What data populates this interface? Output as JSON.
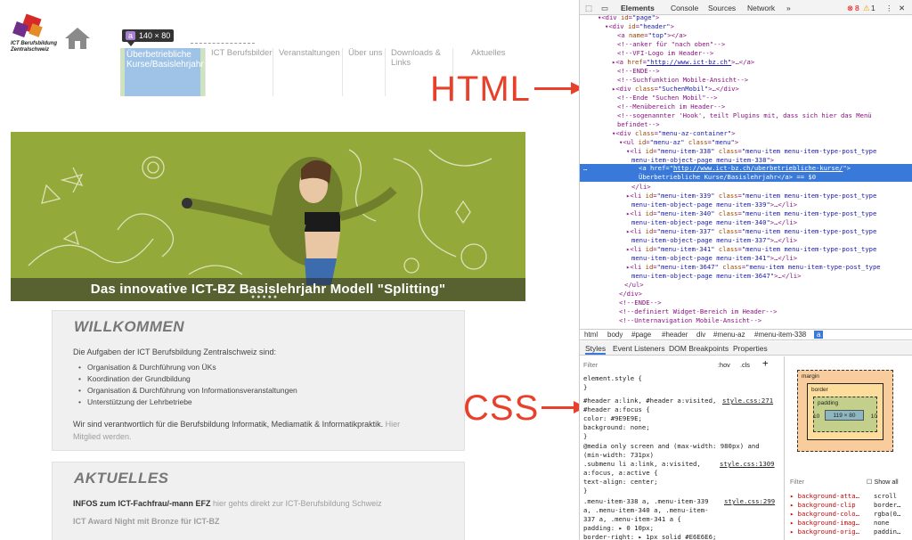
{
  "site": {
    "logo_text_1": "ICT Berufsbildung",
    "logo_text_2": "Zentralschweiz",
    "tooltip_tag": "a",
    "tooltip_size": "140 × 80",
    "nav": [
      {
        "label": "Überbetriebliche Kurse/Basislehrjahr"
      },
      {
        "label": "ICT Berufsbilder"
      },
      {
        "label": "Veranstaltungen"
      },
      {
        "label": "Über uns"
      },
      {
        "label": "Downloads & Links"
      },
      {
        "label": "Aktuelles"
      }
    ],
    "banner_caption": "Das innovative ICT-BZ Basislehrjahr Modell \"Splitting\"",
    "welcome_title": "WILLKOMMEN",
    "welcome_intro": "Die Aufgaben der ICT Berufsbildung Zentralschweiz sind:",
    "welcome_items": [
      "Organisation & Durchführung von ÜKs",
      "Koordination der Grundbildung",
      "Organisation & Durchführung von Informationsveranstaltungen",
      "Unterstützung der Lehrbetriebe"
    ],
    "welcome_resp": "Wir sind verantwortlich für die Berufsbildung Informatik, Mediamatik & Informatikpraktik.",
    "welcome_member_a": "Hier",
    "welcome_member_b": "Mitglied werden.",
    "news_title": "AKTUELLES",
    "news_1_bold": "INFOS zum ICT-Fachfrau/-mann EFZ",
    "news_1_rest": " hier gehts direkt zur ICT-Berufsbildung Schweiz",
    "news_2": "ICT Award Night mit Bronze für ICT-BZ"
  },
  "annotations": {
    "html_label": "HTML",
    "css_label": "CSS",
    "color": "#e8402b"
  },
  "devtools": {
    "tabs": [
      "Elements",
      "Console",
      "Sources",
      "Network",
      "»"
    ],
    "error_count": "8",
    "warning_count": "1",
    "breadcrumb": [
      "html",
      "body",
      "#page",
      "#header",
      "div",
      "#menu-az",
      "#menu-item-338",
      "a"
    ],
    "style_tabs": [
      "Styles",
      "Event Listeners",
      "DOM Breakpoints",
      "Properties"
    ],
    "filter_placeholder": "Filter",
    "hov": ":hov",
    "cls": ".cls",
    "styles": [
      "element.style {",
      "}",
      "#header a:link, #header a:visited,",
      "#header a:focus {",
      "  color: #9E9E9E;",
      "  background: none;",
      "}",
      "@media only screen and (max-width: 980px) and",
      "(min-width: 731px)",
      ".submenu li a:link, a:visited,",
      "a:focus, a:active {",
      "  text-align: center;",
      "}",
      ".menu-item-338 a, .menu-item-339",
      "a, .menu-item-340 a, .menu-item-",
      "337 a, .menu-item-341 a {",
      "  padding: ▸ 0 10px;",
      "  border-right: ▸ 1px solid #E6E6E6;"
    ],
    "style_links": [
      "style.css:271",
      "style.css:1309",
      "style.css:299"
    ],
    "box_model": {
      "margin": "margin",
      "border": "border",
      "padding": "padding",
      "content": "119 × 80",
      "left": "10",
      "right": "10",
      "dash": "-"
    },
    "computed_filter": "Filter",
    "show_all": "Show all",
    "computed": [
      [
        "background-atta…",
        "scroll"
      ],
      [
        "background-clip",
        "border…"
      ],
      [
        "background-colo…",
        "rgba(0…"
      ],
      [
        "background-imag…",
        "none"
      ],
      [
        "background-orig…",
        "paddin…"
      ]
    ]
  }
}
